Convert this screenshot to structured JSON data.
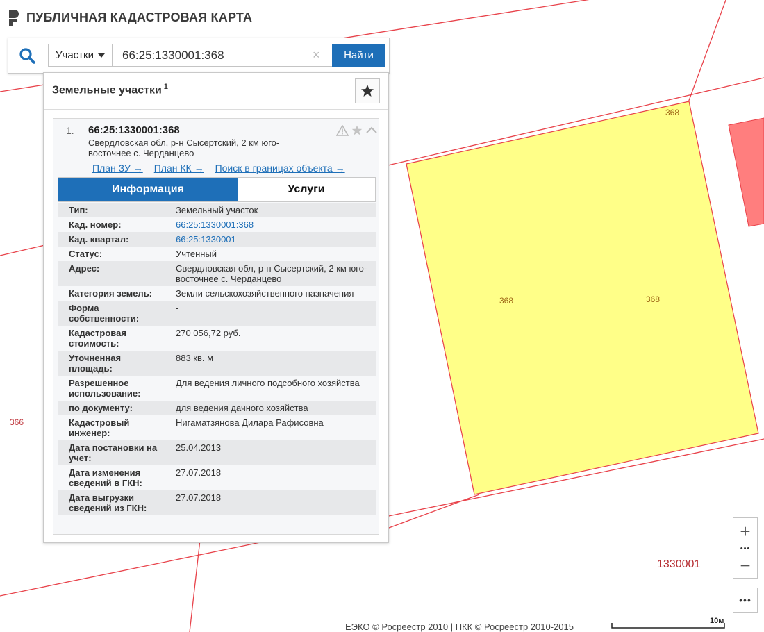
{
  "header": {
    "title": "ПУБЛИЧНАЯ КАДАСТРОВАЯ КАРТА"
  },
  "search": {
    "type_label": "Участки",
    "query": "66:25:1330001:368",
    "clear_symbol": "×",
    "find_label": "Найти"
  },
  "panel": {
    "title": "Земельные участки",
    "count": "1",
    "item": {
      "number": "1.",
      "cadnum": "66:25:1330001:368",
      "address": "Свердловская обл, р-н Сысертский, 2 км юго-восточнее с. Черданцево",
      "links": [
        "План ЗУ →",
        "План КК →",
        "Поиск в границах объекта →"
      ],
      "tabs": {
        "info": "Информация",
        "services": "Услуги"
      },
      "rows": [
        {
          "k": "Тип:",
          "v": "Земельный участок"
        },
        {
          "k": "Кад. номер:",
          "v": "66:25:1330001:368"
        },
        {
          "k": "Кад. квартал:",
          "v": "66:25:1330001"
        },
        {
          "k": "Статус:",
          "v": "Учтенный"
        },
        {
          "k": "Адрес:",
          "v": "Свердловская обл, р-н Сысертский, 2 км юго-восточнее с. Черданцево"
        },
        {
          "k": "Категория земель:",
          "v": "Земли сельскохозяйственного назначения"
        },
        {
          "k": "Форма собственности:",
          "v": "-"
        },
        {
          "k": "Кадастровая стоимость:",
          "v": "270 056,72 руб."
        },
        {
          "k": "Уточненная площадь:",
          "v": "883 кв. м"
        },
        {
          "k": "Разрешенное использование:",
          "v": "Для ведения личного подсобного хозяйства"
        },
        {
          "k": "по документу:",
          "v": "для ведения дачного хозяйства"
        },
        {
          "k": "Кадастровый инженер:",
          "v": "Нигаматзянова Дилара Рафисовна"
        },
        {
          "k": "Дата постановки на учет:",
          "v": "25.04.2013"
        },
        {
          "k": "Дата изменения сведений в ГКН:",
          "v": "27.07.2018"
        },
        {
          "k": "Дата выгрузки сведений из ГКН:",
          "v": "27.07.2018"
        }
      ]
    }
  },
  "map": {
    "labels": {
      "parcel_top": "368",
      "parcel_left": "368",
      "parcel_right": "368",
      "neighbor": "366",
      "quarter": "1330001"
    },
    "colors": {
      "parcel_fill": "#ffff88",
      "boundary": "#e8424a",
      "neighbor_fill": "#ff7e7e"
    }
  },
  "controls": {
    "zoom_in": "+",
    "zoom_dots": "•••",
    "zoom_out": "−",
    "more": "•••"
  },
  "footer": {
    "attribution": "ЕЭКО © Росреестр 2010 | ПКК © Росреестр 2010-2015",
    "scale": "10м"
  }
}
